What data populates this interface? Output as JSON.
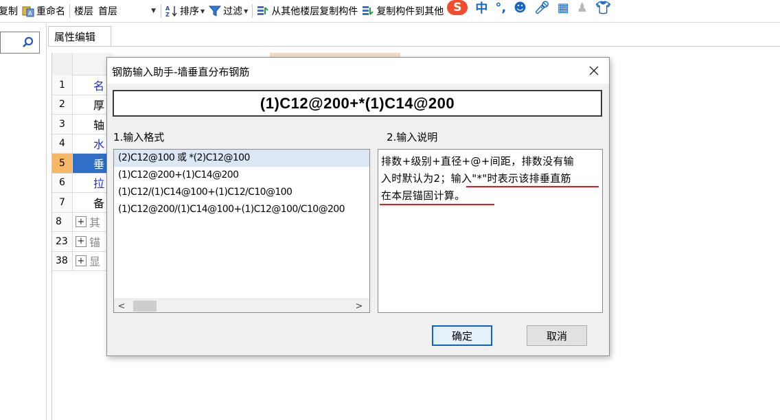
{
  "toolbar": {
    "copy_partial": "复制",
    "rename": "重命名",
    "floor_label": "楼层",
    "floor_value": "首层",
    "sort": "排序",
    "filter": "过滤",
    "copy_from_other": "从其他楼层复制构件",
    "copy_to_other": "复制构件到其他",
    "ime_zh": "中"
  },
  "property_panel": {
    "tab_title": "属性编辑",
    "rows": [
      {
        "num": "1",
        "label": "名"
      },
      {
        "num": "2",
        "label": "厚"
      },
      {
        "num": "3",
        "label": "轴"
      },
      {
        "num": "4",
        "label": "水"
      },
      {
        "num": "5",
        "label": "垂"
      },
      {
        "num": "6",
        "label": "拉"
      },
      {
        "num": "7",
        "label": "备"
      },
      {
        "num": "8",
        "label": "其"
      },
      {
        "num": "23",
        "label": "锚"
      },
      {
        "num": "38",
        "label": "显"
      }
    ]
  },
  "dialog": {
    "title": "钢筋输入助手-墙垂直分布钢筋",
    "formula": "(1)C12@200+*(1)C14@200",
    "format_label": "1.输入格式",
    "desc_label": "2.输入说明",
    "formats": [
      "(2)C12@100 或 *(2)C12@100",
      "(1)C12@200+(1)C14@200",
      "(1)C12/(1)C14@100+(1)C12/C10@100",
      "(1)C12@200/(1)C14@100+(1)C12@100/C10@200"
    ],
    "desc_lines": [
      "排数+级别+直径+@+间距，排数没有输",
      "入时默认为2；输入\"*\"时表示该排垂直筋",
      "在本层锚固计算。"
    ],
    "ok": "确定",
    "cancel": "取消"
  }
}
